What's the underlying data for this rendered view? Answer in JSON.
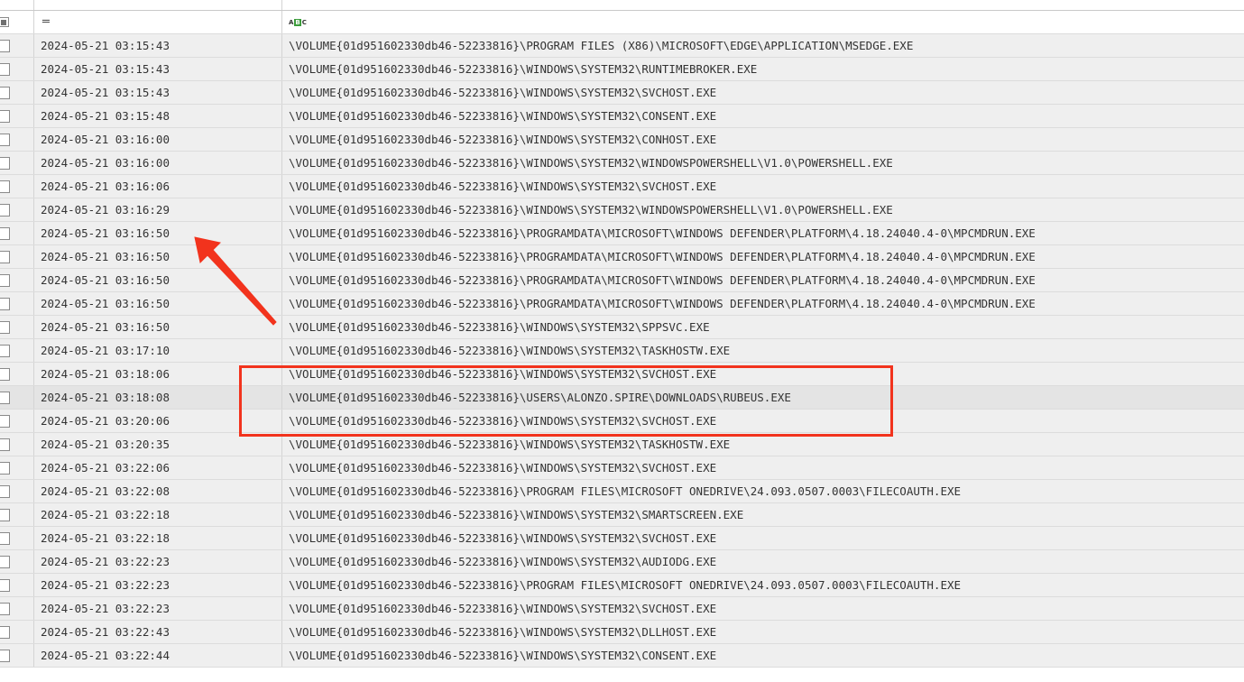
{
  "table": {
    "filter_row": {
      "time_filter_icon": "equals-icon",
      "name_filter_icon": "abc-text-filter-icon",
      "abc_left": "A",
      "abc_mid": "B",
      "abc_right": "C"
    },
    "rows": [
      {
        "time": "2024-05-21 03:15:43",
        "path": "\\VOLUME{01d951602330db46-52233816}\\PROGRAM FILES (X86)\\MICROSOFT\\EDGE\\APPLICATION\\MSEDGE.EXE"
      },
      {
        "time": "2024-05-21 03:15:43",
        "path": "\\VOLUME{01d951602330db46-52233816}\\WINDOWS\\SYSTEM32\\RUNTIMEBROKER.EXE"
      },
      {
        "time": "2024-05-21 03:15:43",
        "path": "\\VOLUME{01d951602330db46-52233816}\\WINDOWS\\SYSTEM32\\SVCHOST.EXE"
      },
      {
        "time": "2024-05-21 03:15:48",
        "path": "\\VOLUME{01d951602330db46-52233816}\\WINDOWS\\SYSTEM32\\CONSENT.EXE"
      },
      {
        "time": "2024-05-21 03:16:00",
        "path": "\\VOLUME{01d951602330db46-52233816}\\WINDOWS\\SYSTEM32\\CONHOST.EXE"
      },
      {
        "time": "2024-05-21 03:16:00",
        "path": "\\VOLUME{01d951602330db46-52233816}\\WINDOWS\\SYSTEM32\\WINDOWSPOWERSHELL\\V1.0\\POWERSHELL.EXE"
      },
      {
        "time": "2024-05-21 03:16:06",
        "path": "\\VOLUME{01d951602330db46-52233816}\\WINDOWS\\SYSTEM32\\SVCHOST.EXE"
      },
      {
        "time": "2024-05-21 03:16:29",
        "path": "\\VOLUME{01d951602330db46-52233816}\\WINDOWS\\SYSTEM32\\WINDOWSPOWERSHELL\\V1.0\\POWERSHELL.EXE"
      },
      {
        "time": "2024-05-21 03:16:50",
        "path": "\\VOLUME{01d951602330db46-52233816}\\PROGRAMDATA\\MICROSOFT\\WINDOWS DEFENDER\\PLATFORM\\4.18.24040.4-0\\MPCMDRUN.EXE"
      },
      {
        "time": "2024-05-21 03:16:50",
        "path": "\\VOLUME{01d951602330db46-52233816}\\PROGRAMDATA\\MICROSOFT\\WINDOWS DEFENDER\\PLATFORM\\4.18.24040.4-0\\MPCMDRUN.EXE"
      },
      {
        "time": "2024-05-21 03:16:50",
        "path": "\\VOLUME{01d951602330db46-52233816}\\PROGRAMDATA\\MICROSOFT\\WINDOWS DEFENDER\\PLATFORM\\4.18.24040.4-0\\MPCMDRUN.EXE"
      },
      {
        "time": "2024-05-21 03:16:50",
        "path": "\\VOLUME{01d951602330db46-52233816}\\PROGRAMDATA\\MICROSOFT\\WINDOWS DEFENDER\\PLATFORM\\4.18.24040.4-0\\MPCMDRUN.EXE"
      },
      {
        "time": "2024-05-21 03:16:50",
        "path": "\\VOLUME{01d951602330db46-52233816}\\WINDOWS\\SYSTEM32\\SPPSVC.EXE"
      },
      {
        "time": "2024-05-21 03:17:10",
        "path": "\\VOLUME{01d951602330db46-52233816}\\WINDOWS\\SYSTEM32\\TASKHOSTW.EXE"
      },
      {
        "time": "2024-05-21 03:18:06",
        "path": "\\VOLUME{01d951602330db46-52233816}\\WINDOWS\\SYSTEM32\\SVCHOST.EXE"
      },
      {
        "time": "2024-05-21 03:18:08",
        "path": "\\VOLUME{01d951602330db46-52233816}\\USERS\\ALONZO.SPIRE\\DOWNLOADS\\RUBEUS.EXE",
        "selected": true
      },
      {
        "time": "2024-05-21 03:20:06",
        "path": "\\VOLUME{01d951602330db46-52233816}\\WINDOWS\\SYSTEM32\\SVCHOST.EXE"
      },
      {
        "time": "2024-05-21 03:20:35",
        "path": "\\VOLUME{01d951602330db46-52233816}\\WINDOWS\\SYSTEM32\\TASKHOSTW.EXE"
      },
      {
        "time": "2024-05-21 03:22:06",
        "path": "\\VOLUME{01d951602330db46-52233816}\\WINDOWS\\SYSTEM32\\SVCHOST.EXE"
      },
      {
        "time": "2024-05-21 03:22:08",
        "path": "\\VOLUME{01d951602330db46-52233816}\\PROGRAM FILES\\MICROSOFT ONEDRIVE\\24.093.0507.0003\\FILECOAUTH.EXE"
      },
      {
        "time": "2024-05-21 03:22:18",
        "path": "\\VOLUME{01d951602330db46-52233816}\\WINDOWS\\SYSTEM32\\SMARTSCREEN.EXE"
      },
      {
        "time": "2024-05-21 03:22:18",
        "path": "\\VOLUME{01d951602330db46-52233816}\\WINDOWS\\SYSTEM32\\SVCHOST.EXE"
      },
      {
        "time": "2024-05-21 03:22:23",
        "path": "\\VOLUME{01d951602330db46-52233816}\\WINDOWS\\SYSTEM32\\AUDIODG.EXE"
      },
      {
        "time": "2024-05-21 03:22:23",
        "path": "\\VOLUME{01d951602330db46-52233816}\\PROGRAM FILES\\MICROSOFT ONEDRIVE\\24.093.0507.0003\\FILECOAUTH.EXE"
      },
      {
        "time": "2024-05-21 03:22:23",
        "path": "\\VOLUME{01d951602330db46-52233816}\\WINDOWS\\SYSTEM32\\SVCHOST.EXE"
      },
      {
        "time": "2024-05-21 03:22:43",
        "path": "\\VOLUME{01d951602330db46-52233816}\\WINDOWS\\SYSTEM32\\DLLHOST.EXE"
      },
      {
        "time": "2024-05-21 03:22:44",
        "path": "\\VOLUME{01d951602330db46-52233816}\\WINDOWS\\SYSTEM32\\CONSENT.EXE"
      }
    ]
  },
  "annotations": {
    "arrow_color": "#f2331d",
    "box_color": "#f2331d",
    "arrow_icon": "red-arrow-annotation",
    "box_icon": "red-highlight-box"
  }
}
